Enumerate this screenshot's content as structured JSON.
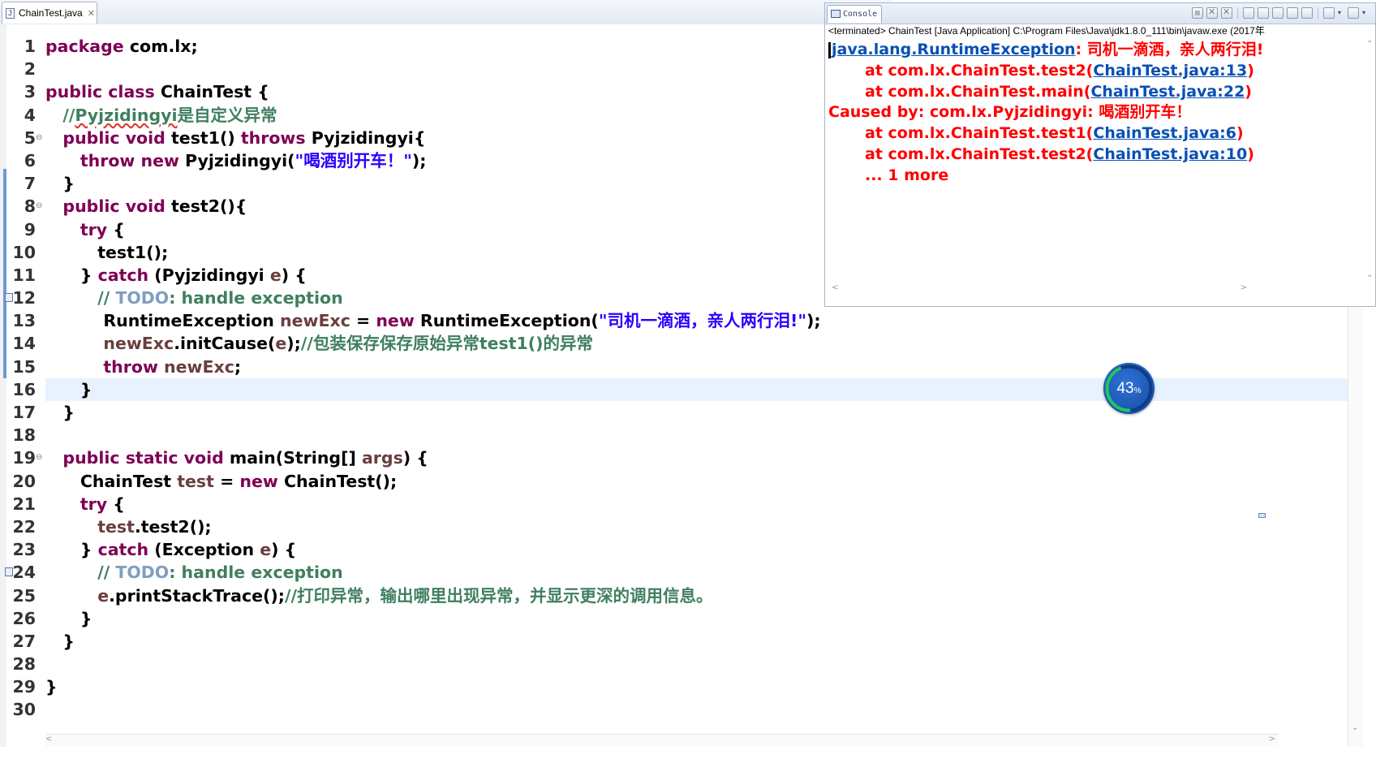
{
  "editor": {
    "tab_title": "ChainTest.java",
    "file_icon": "java-file-icon",
    "lines": [
      {
        "n": "1",
        "tokens": [
          {
            "t": "package",
            "c": "kw"
          },
          {
            "t": " com.lx;",
            "c": "pl"
          }
        ]
      },
      {
        "n": "2",
        "tokens": []
      },
      {
        "n": "3",
        "tokens": [
          {
            "t": "public class",
            "c": "kw"
          },
          {
            "t": " ChainTest {",
            "c": "pl"
          }
        ]
      },
      {
        "n": "4",
        "tokens": [
          {
            "t": "   //",
            "c": "cm"
          },
          {
            "t": "Pyjzidingyi",
            "c": "cm sq"
          },
          {
            "t": "是自定义异常",
            "c": "cm"
          }
        ]
      },
      {
        "n": "5",
        "fold": "⊖",
        "tokens": [
          {
            "t": "   public void",
            "c": "kw"
          },
          {
            "t": " test1() ",
            "c": "pl"
          },
          {
            "t": "throws",
            "c": "kw"
          },
          {
            "t": " Pyjzidingyi{",
            "c": "pl"
          }
        ]
      },
      {
        "n": "6",
        "tokens": [
          {
            "t": "      throw new",
            "c": "kw"
          },
          {
            "t": " Pyjzidingyi(",
            "c": "pl"
          },
          {
            "t": "\"喝酒别开车！\"",
            "c": "st"
          },
          {
            "t": ");",
            "c": "pl"
          }
        ]
      },
      {
        "n": "7",
        "tokens": [
          {
            "t": "   }",
            "c": "pl"
          }
        ]
      },
      {
        "n": "8",
        "fold": "⊖",
        "tokens": [
          {
            "t": "   public void",
            "c": "kw"
          },
          {
            "t": " test2(){",
            "c": "pl"
          }
        ]
      },
      {
        "n": "9",
        "tokens": [
          {
            "t": "      try",
            "c": "kw"
          },
          {
            "t": " {",
            "c": "pl"
          }
        ]
      },
      {
        "n": "10",
        "tokens": [
          {
            "t": "         test1();",
            "c": "pl"
          }
        ]
      },
      {
        "n": "11",
        "tokens": [
          {
            "t": "      } ",
            "c": "pl"
          },
          {
            "t": "catch",
            "c": "kw"
          },
          {
            "t": " (Pyjzidingyi ",
            "c": "pl"
          },
          {
            "t": "e",
            "c": "va"
          },
          {
            "t": ") {",
            "c": "pl"
          }
        ]
      },
      {
        "n": "12",
        "marker": true,
        "tokens": [
          {
            "t": "         // ",
            "c": "cm"
          },
          {
            "t": "TODO",
            "c": "td"
          },
          {
            "t": ": handle exception",
            "c": "cm"
          }
        ]
      },
      {
        "n": "13",
        "tokens": [
          {
            "t": "          RuntimeException ",
            "c": "pl"
          },
          {
            "t": "newExc",
            "c": "va"
          },
          {
            "t": " = ",
            "c": "pl"
          },
          {
            "t": "new",
            "c": "kw"
          },
          {
            "t": " RuntimeException(",
            "c": "pl"
          },
          {
            "t": "\"司机一滴酒，亲人两行泪!\"",
            "c": "st"
          },
          {
            "t": ");",
            "c": "pl"
          }
        ]
      },
      {
        "n": "14",
        "tokens": [
          {
            "t": "          newExc",
            "c": "va"
          },
          {
            "t": ".initCause(",
            "c": "pl"
          },
          {
            "t": "e",
            "c": "va"
          },
          {
            "t": ");",
            "c": "pl"
          },
          {
            "t": "//包装保存保存原始异常test1()的异常",
            "c": "cm"
          }
        ]
      },
      {
        "n": "15",
        "tokens": [
          {
            "t": "          throw",
            "c": "kw"
          },
          {
            "t": " newExc",
            "c": "va"
          },
          {
            "t": ";",
            "c": "pl"
          }
        ]
      },
      {
        "n": "16",
        "current": true,
        "tokens": [
          {
            "t": "      }",
            "c": "pl"
          }
        ]
      },
      {
        "n": "17",
        "tokens": [
          {
            "t": "   }",
            "c": "pl"
          }
        ]
      },
      {
        "n": "18",
        "tokens": []
      },
      {
        "n": "19",
        "fold": "⊖",
        "tokens": [
          {
            "t": "   public static void",
            "c": "kw"
          },
          {
            "t": " main(String[] ",
            "c": "pl"
          },
          {
            "t": "args",
            "c": "va"
          },
          {
            "t": ") {",
            "c": "pl"
          }
        ]
      },
      {
        "n": "20",
        "tokens": [
          {
            "t": "      ChainTest ",
            "c": "pl"
          },
          {
            "t": "test",
            "c": "va"
          },
          {
            "t": " = ",
            "c": "pl"
          },
          {
            "t": "new",
            "c": "kw"
          },
          {
            "t": " ChainTest();",
            "c": "pl"
          }
        ]
      },
      {
        "n": "21",
        "tokens": [
          {
            "t": "      try",
            "c": "kw"
          },
          {
            "t": " {",
            "c": "pl"
          }
        ]
      },
      {
        "n": "22",
        "tokens": [
          {
            "t": "         test",
            "c": "va"
          },
          {
            "t": ".test2();",
            "c": "pl"
          }
        ]
      },
      {
        "n": "23",
        "tokens": [
          {
            "t": "      } ",
            "c": "pl"
          },
          {
            "t": "catch",
            "c": "kw"
          },
          {
            "t": " (Exception ",
            "c": "pl"
          },
          {
            "t": "e",
            "c": "va"
          },
          {
            "t": ") {",
            "c": "pl"
          }
        ]
      },
      {
        "n": "24",
        "marker": true,
        "tokens": [
          {
            "t": "         // ",
            "c": "cm"
          },
          {
            "t": "TODO",
            "c": "td"
          },
          {
            "t": ": handle exception",
            "c": "cm"
          }
        ]
      },
      {
        "n": "25",
        "tokens": [
          {
            "t": "         e",
            "c": "va"
          },
          {
            "t": ".printStackTrace();",
            "c": "pl"
          },
          {
            "t": "//打印异常，输出哪里出现异常，并显示更深的调用信息。",
            "c": "cm"
          }
        ]
      },
      {
        "n": "26",
        "tokens": [
          {
            "t": "      }",
            "c": "pl"
          }
        ]
      },
      {
        "n": "27",
        "tokens": [
          {
            "t": "   }",
            "c": "pl"
          }
        ]
      },
      {
        "n": "28",
        "tokens": []
      },
      {
        "n": "29",
        "tokens": [
          {
            "t": "}",
            "c": "pl"
          }
        ]
      },
      {
        "n": "30",
        "tokens": []
      }
    ]
  },
  "console": {
    "tab_label": "Console",
    "tab_icon": "console-icon",
    "toolbar_icons": [
      "terminate-icon",
      "remove-launch-icon",
      "remove-all-icon",
      "scroll-lock-icon",
      "word-wrap-icon",
      "show-on-output-icon",
      "show-on-error-icon",
      "pin-console-icon",
      "display-console-icon",
      "new-console-icon"
    ],
    "launch_info": "<terminated> ChainTest [Java Application] C:\\Program Files\\Java\\jdk1.8.0_111\\bin\\javaw.exe (2017年",
    "output": [
      {
        "indent": false,
        "parts": [
          {
            "t": "java.lang.RuntimeException",
            "link": true
          },
          {
            "t": ": 司机一滴酒，亲人两行泪!",
            "link": false
          }
        ]
      },
      {
        "indent": true,
        "parts": [
          {
            "t": "at com.lx.ChainTest.test2(",
            "link": false
          },
          {
            "t": "ChainTest.java:13",
            "link": true
          },
          {
            "t": ")",
            "link": false
          }
        ]
      },
      {
        "indent": true,
        "parts": [
          {
            "t": "at com.lx.ChainTest.main(",
            "link": false
          },
          {
            "t": "ChainTest.java:22",
            "link": true
          },
          {
            "t": ")",
            "link": false
          }
        ]
      },
      {
        "indent": false,
        "parts": [
          {
            "t": "Caused by: com.lx.Pyjzidingyi: 喝酒别开车！",
            "link": false
          }
        ]
      },
      {
        "indent": true,
        "parts": [
          {
            "t": "at com.lx.ChainTest.test1(",
            "link": false
          },
          {
            "t": "ChainTest.java:6",
            "link": true
          },
          {
            "t": ")",
            "link": false
          }
        ]
      },
      {
        "indent": true,
        "parts": [
          {
            "t": "at com.lx.ChainTest.test2(",
            "link": false
          },
          {
            "t": "ChainTest.java:10",
            "link": true
          },
          {
            "t": ")",
            "link": false
          }
        ]
      },
      {
        "indent": true,
        "parts": [
          {
            "t": "... 1 more",
            "link": false
          }
        ]
      }
    ],
    "error_color": "#ff0000",
    "link_color": "#0a50b4"
  },
  "meter": {
    "value": "43",
    "unit": "%",
    "fraction": 0.43,
    "ring_color": "#22c55e"
  }
}
